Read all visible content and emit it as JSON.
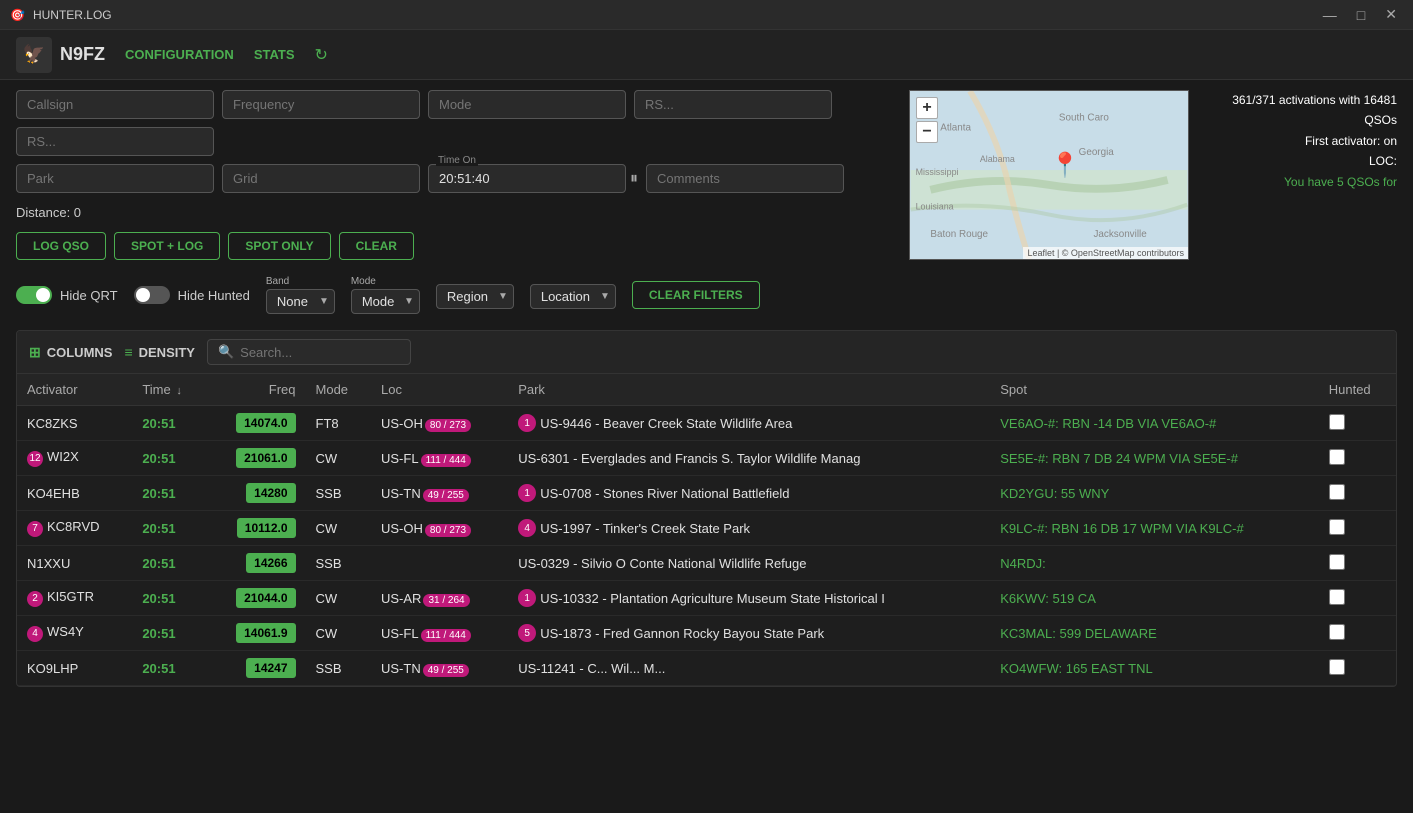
{
  "titlebar": {
    "title": "HUNTER.LOG",
    "minimize": "—",
    "maximize": "□",
    "close": "✕"
  },
  "header": {
    "callsign": "N9FZ",
    "nav": {
      "configuration": "CONFIGURATION",
      "stats": "STATS"
    },
    "refresh_icon": "↻"
  },
  "controls": {
    "callsign_placeholder": "Callsign",
    "frequency_placeholder": "Frequency",
    "mode_placeholder": "Mode",
    "rs1_placeholder": "RS...",
    "rs2_placeholder": "RS...",
    "park_placeholder": "Park",
    "grid_placeholder": "Grid",
    "time_label": "Time On",
    "time_value": "20:51:40",
    "comments_placeholder": "Comments",
    "distance_label": "Distance: 0",
    "buttons": {
      "log_qso": "LOG QSO",
      "spot_log": "SPOT + LOG",
      "spot_only": "SPOT ONLY",
      "clear": "CLEAR"
    }
  },
  "map": {
    "zoom_in": "+",
    "zoom_out": "−",
    "attribution": "Leaflet | © OpenStreetMap contributors",
    "stats": {
      "line1": "361/371 activations with 16481",
      "line2": "QSOs",
      "line3": "First activator: on",
      "line4": "LOC:",
      "line5": "You have 5 QSOs for"
    }
  },
  "filters": {
    "hide_qrt_label": "Hide QRT",
    "hide_qrt_on": true,
    "hide_hunted_label": "Hide Hunted",
    "hide_hunted_on": false,
    "band_label": "Band",
    "band_value": "None",
    "mode_label": "Mode",
    "region_label": "Region",
    "location_label": "Location",
    "clear_filters": "CLEAR FILTERS"
  },
  "table": {
    "toolbar": {
      "columns_label": "COLUMNS",
      "density_label": "DENSITY",
      "search_placeholder": "Search..."
    },
    "columns": [
      "Activator",
      "Time ↓",
      "Freq",
      "Mode",
      "Loc",
      "Park",
      "Spot",
      "Hunted"
    ],
    "rows": [
      {
        "activator": "KC8ZKS",
        "time": "20:51",
        "freq": "14074.0",
        "mode": "FT8",
        "loc": "US-OH",
        "loc_badge": "80 / 273",
        "park_count": "1",
        "park": "US-9446 - Beaver Creek State Wildlife Area",
        "spot": "VE6AO-#: RBN -14 DB VIA VE6AO-#",
        "hunted": false
      },
      {
        "activator": "WI2X",
        "activator_badge": "12",
        "time": "20:51",
        "freq": "21061.0",
        "mode": "CW",
        "loc": "US-FL",
        "loc_badge": "111 / 444",
        "park_count": null,
        "park": "US-6301 - Everglades and Francis S. Taylor Wildlife Manag",
        "spot": "SE5E-#: RBN 7 DB 24 WPM VIA SE5E-#",
        "hunted": false
      },
      {
        "activator": "KO4EHB",
        "time": "20:51",
        "freq": "14280",
        "mode": "SSB",
        "loc": "US-TN",
        "loc_badge": "49 / 255",
        "park_count": "1",
        "park": "US-0708 - Stones River National Battlefield",
        "spot": "KD2YGU: 55 WNY",
        "hunted": false
      },
      {
        "activator": "KC8RVD",
        "activator_badge": "7",
        "time": "20:51",
        "freq": "10112.0",
        "mode": "CW",
        "loc": "US-OH",
        "loc_badge": "80 / 273",
        "park_count": "4",
        "park": "US-1997 - Tinker's Creek State Park",
        "spot": "K9LC-#: RBN 16 DB 17 WPM VIA K9LC-#",
        "hunted": false
      },
      {
        "activator": "N1XXU",
        "time": "20:51",
        "freq": "14266",
        "mode": "SSB",
        "loc": "",
        "loc_badge": null,
        "park_count": null,
        "park": "US-0329 - Silvio O Conte National Wildlife Refuge",
        "spot": "N4RDJ:",
        "hunted": false
      },
      {
        "activator": "KI5GTR",
        "activator_badge": "2",
        "time": "20:51",
        "freq": "21044.0",
        "mode": "CW",
        "loc": "US-AR",
        "loc_badge": "31 / 264",
        "park_count": "1",
        "park": "US-10332 - Plantation Agriculture Museum State Historical I",
        "spot": "K6KWV: 519 CA",
        "hunted": false
      },
      {
        "activator": "WS4Y",
        "activator_badge": "4",
        "time": "20:51",
        "freq": "14061.9",
        "mode": "CW",
        "loc": "US-FL",
        "loc_badge": "111 / 444",
        "park_count": "5",
        "park": "US-1873 - Fred Gannon Rocky Bayou State Park",
        "spot": "KC3MAL: 599 DELAWARE",
        "hunted": false
      },
      {
        "activator": "KO9LHP",
        "time": "20:51",
        "freq": "14247",
        "mode": "SSB",
        "loc": "US-TN",
        "loc_badge": "49 / 255",
        "park_count": null,
        "park": "US-11241 - C... Wil... M...",
        "spot": "KO4WFW: 165 EAST TNL",
        "hunted": false
      }
    ]
  }
}
